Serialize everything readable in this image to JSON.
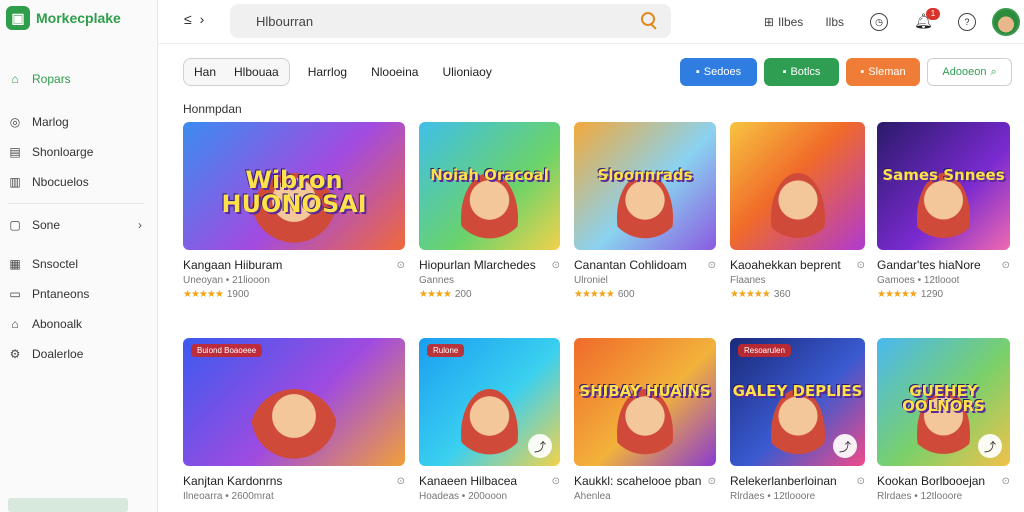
{
  "app": {
    "name": "Morkecplake"
  },
  "sidebar": {
    "items": [
      {
        "label": "Ropars",
        "icon": "home-icon"
      },
      {
        "label": "Marlog",
        "icon": "tag-icon"
      },
      {
        "label": "Shonloarge",
        "icon": "store-icon"
      },
      {
        "label": "Nbocuelos",
        "icon": "grid-icon"
      },
      {
        "label": "Sone",
        "icon": "folder-icon"
      },
      {
        "label": "Snsoctel",
        "icon": "calendar-icon"
      },
      {
        "label": "Pntaneons",
        "icon": "monitor-icon"
      },
      {
        "label": "Abonoalk",
        "icon": "bookmark-icon"
      },
      {
        "label": "Doalerloe",
        "icon": "settings-icon"
      }
    ]
  },
  "topbar": {
    "search_value": "Hlbourran",
    "links": [
      {
        "label": "Ilbes",
        "icon": "list-icon"
      },
      {
        "label": "Ilbs",
        "icon": "image-icon"
      }
    ],
    "notification_count": "1"
  },
  "filters": {
    "segment": [
      "Han",
      "Hlbouaa"
    ],
    "tabs": [
      "Harrlog",
      "Nlooeina",
      "Ulioniaoy"
    ],
    "actions": [
      {
        "label": "Sedoes",
        "color": "#2f7de1"
      },
      {
        "label": "Botlcs",
        "color": "#2f9e53"
      },
      {
        "label": "Sleman",
        "color": "#f07d37"
      },
      {
        "label": "Adooeon",
        "color": "#2f9e53"
      }
    ]
  },
  "section_title": "Honmpdan",
  "cards": [
    {
      "thumb_text": "Wibron HUONOSAI",
      "title": "Kangaan Hiiburam",
      "subtitle": "Uneoyan • 21liooon",
      "stars": "★★★★★",
      "rating": "1900",
      "bg": "linear-gradient(135deg,#3b8cf0,#a24be0 55%,#f06a3a)"
    },
    {
      "thumb_text": "Noiah Oracoal",
      "title": "Hiopurlan Mlarchedes",
      "subtitle": "Gannes",
      "stars": "★★★★",
      "rating": "200",
      "bg": "linear-gradient(135deg,#3fbfe8,#6bd36a 60%,#f2d24b)"
    },
    {
      "thumb_text": "Sloonnrads",
      "title": "Canantan Cohlidoam",
      "subtitle": "Ulroniel",
      "stars": "★★★★★",
      "rating": "600",
      "bg": "linear-gradient(135deg,#f2a93b,#8ad2f0 55%,#8a5ae0)"
    },
    {
      "thumb_text": "",
      "title": "Kaoahekkan beprent",
      "subtitle": "Flaanes",
      "stars": "★★★★★",
      "rating": "360",
      "bg": "linear-gradient(135deg,#f7c441,#f06a2a 45%,#b03ad0)"
    },
    {
      "thumb_text": "Sames Snnees",
      "title": "Gandar'tes hiaNore",
      "subtitle": "Gamoes • 12tlooot",
      "stars": "★★★★★",
      "rating": "1290",
      "bg": "linear-gradient(135deg,#2a1a6a,#7a2ad0 60%,#f06ab0)"
    },
    {
      "thumb_text": "",
      "badge": "Buiond Boaoeee",
      "title": "Kanjtan Kardonrns",
      "subtitle": "Ilneoarra • 2600mrat",
      "stars": "",
      "rating": "",
      "bg": "linear-gradient(135deg,#3b5af0,#a04be0 55%,#f0a03a)"
    },
    {
      "thumb_text": "",
      "badge": "Rulone",
      "title": "Kanaeen Hilbacea",
      "subtitle": "Hoadeas • 200ooon",
      "stars": "",
      "rating": "",
      "bg": "linear-gradient(135deg,#1a9ef0,#3ad0f0 55%,#f2d24b)"
    },
    {
      "thumb_text": "SHIBAY HUAINS",
      "title": "Kaukkl: scahelooe pban",
      "subtitle": "Ahenlea",
      "stars": "",
      "rating": "",
      "bg": "linear-gradient(135deg,#f06a2a,#f2b23b 55%,#8a3ad0)"
    },
    {
      "thumb_text": "GALEY DEPLIES",
      "badge": "Resoarulen",
      "title": "Relekerlanberloinan",
      "subtitle": "Rlrdaes • 12tlooore",
      "stars": "",
      "rating": "",
      "bg": "linear-gradient(135deg,#1a2a7a,#3a5ad0 55%,#f04a8a)"
    },
    {
      "thumb_text": "GUEHEY OOLNORS",
      "title": "Kookan Borlbooejan",
      "subtitle": "Rlrdaes • 12tlooore",
      "stars": "",
      "rating": "",
      "bg": "linear-gradient(135deg,#4ab8f0,#7ad06a 55%,#f2c24b)"
    }
  ]
}
